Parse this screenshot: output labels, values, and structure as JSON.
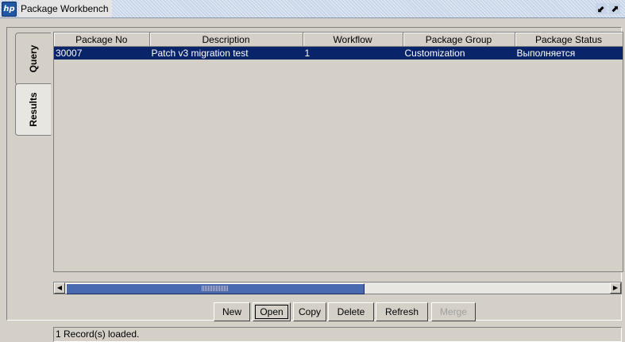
{
  "window": {
    "title": "Package Workbench",
    "logo_icon": "hp-logo-icon",
    "restore_glyph": "⬋",
    "maximize_glyph": "⬈"
  },
  "tabs": [
    {
      "label": "Query",
      "selected": false
    },
    {
      "label": "Results",
      "selected": true
    }
  ],
  "grid": {
    "columns": [
      "Package No",
      "Description",
      "Workflow",
      "Package Group",
      "Package Status"
    ],
    "rows": [
      [
        "30007",
        "Patch v3 migration test",
        "1",
        "Customization",
        "Выполняется"
      ]
    ],
    "selected_row": 0
  },
  "scrollbar": {
    "left_arrow": "◀",
    "right_arrow": "▶"
  },
  "buttons": {
    "new": "New",
    "open": "Open",
    "copy": "Copy",
    "delete": "Delete",
    "refresh": "Refresh",
    "merge": "Merge"
  },
  "status": "1 Record(s) loaded.",
  "colors": {
    "selection": "#0a246a",
    "scroll_thumb": "#4a6ab0"
  }
}
